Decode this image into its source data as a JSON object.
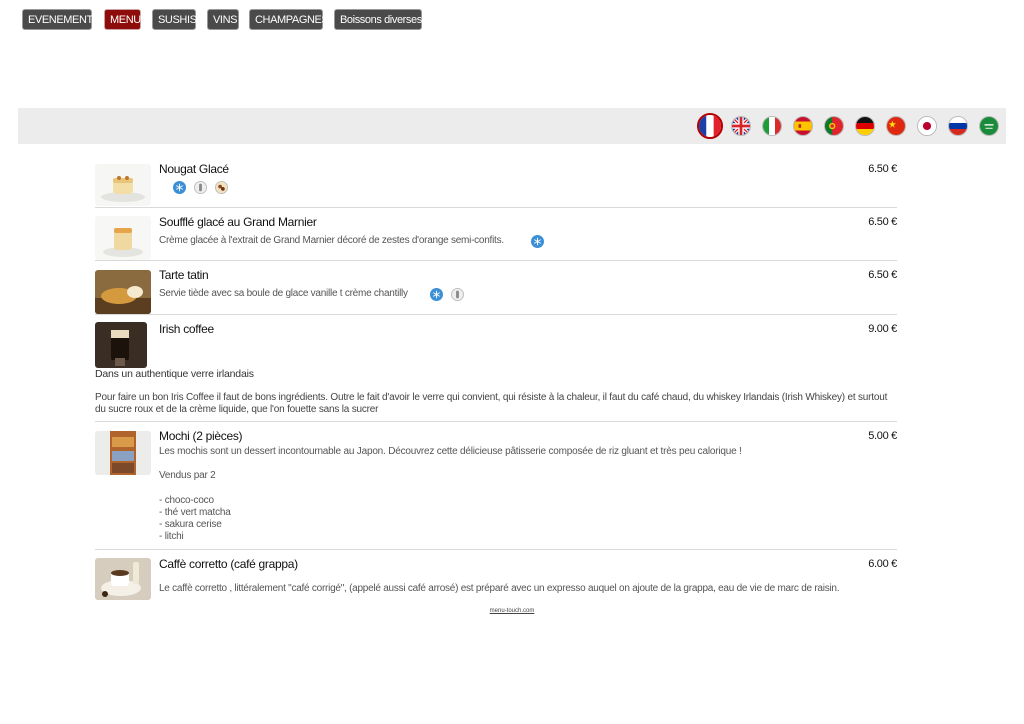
{
  "categories": [
    {
      "label": "EVENEMENTS",
      "active": false
    },
    {
      "label": "MENU",
      "active": true
    },
    {
      "label": "SUSHIS",
      "active": false
    },
    {
      "label": "VINS",
      "active": false
    },
    {
      "label": "CHAMPAGNES",
      "active": false
    },
    {
      "label": "Boissons diverses",
      "active": false
    }
  ],
  "languages": [
    "fr",
    "en",
    "it",
    "es",
    "pt",
    "de",
    "cn",
    "jp",
    "ru",
    "sa"
  ],
  "selected_language": "fr",
  "items": [
    {
      "title": "Nougat Glacé",
      "price": "6.50 €",
      "description": "",
      "icons": [
        "snowflake-icon",
        "bottle-icon",
        "nuts-icon"
      ]
    },
    {
      "title": "Soufflé glacé au Grand Marnier",
      "price": "6.50 €",
      "description": "Crème glacée à l'extrait de Grand Marnier décoré de zestes d'orange semi-confits.",
      "icons": [
        "snowflake-icon"
      ]
    },
    {
      "title": "Tarte tatin",
      "price": "6.50 €",
      "description": "Servie tiède avec sa boule de glace vanille t crème chantilly",
      "icons": [
        "snowflake-icon",
        "bottle-icon"
      ]
    },
    {
      "title": "Irish coffee",
      "price": "9.00 €",
      "subtitle": "Dans un authentique verre irlandais",
      "paragraph": "Pour faire un bon Iris Coffee il faut de bons ingrédients. Outre le fait d'avoir le verre qui convient, qui résiste à la chaleur, il faut du café chaud, du whiskey Irlandais (Irish Whiskey) et surtout du sucre roux et de la crème liquide, que l'on fouette sans la sucrer"
    },
    {
      "title": "Mochi (2 pièces)",
      "price": "5.00 €",
      "lines": [
        "Les mochis sont un dessert incontournable au Japon. Découvrez cette délicieuse pâtisserie composée de riz gluant et très peu calorique !",
        "",
        "Vendus par 2",
        "",
        "- choco-coco",
        "- thé vert matcha",
        "- sakura cerise",
        "- litchi"
      ]
    },
    {
      "title": "Caffè corretto (café grappa)",
      "price": "6.00 €",
      "description": "Le caffè corretto , littéralement \"café corrigé\", (appelé aussi café arrosé) est  préparé avec un expresso auquel on ajoute de la grappa, eau de vie de marc de raisin."
    }
  ],
  "footer": "menu-touch.com",
  "colors": {
    "active_tab": "#8e0c0c",
    "tab": "#4a4a4a",
    "topbar": "#ececec",
    "icon_blue": "#3b8fd6"
  }
}
